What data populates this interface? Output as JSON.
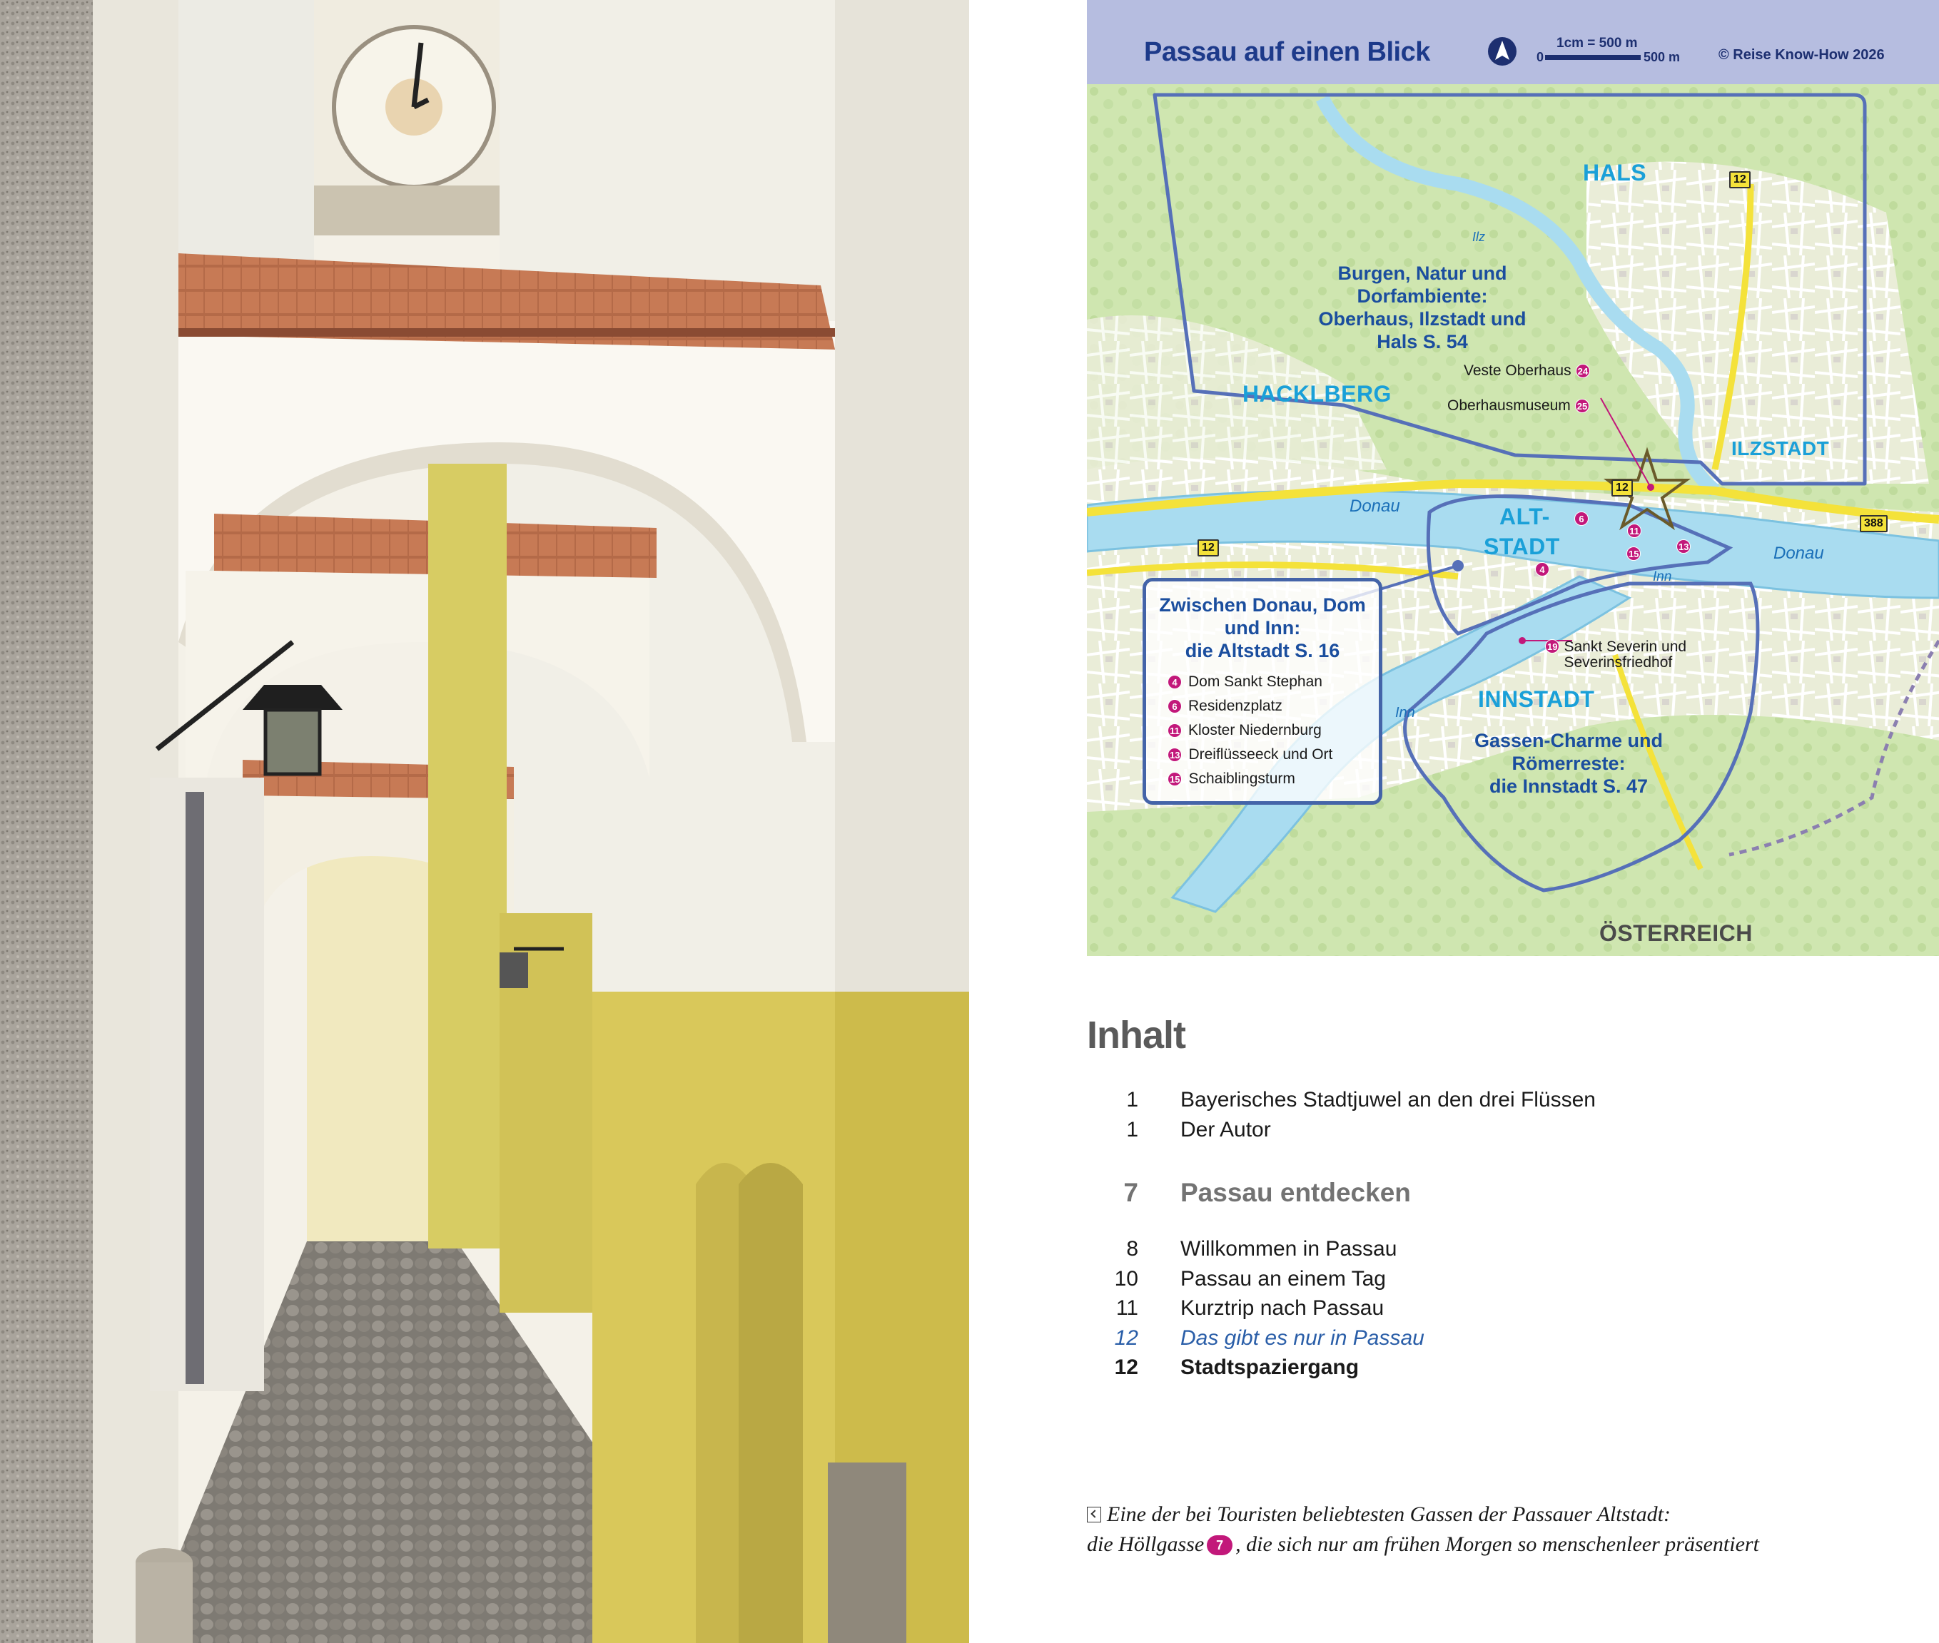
{
  "map": {
    "title": "Passau auf einen Blick",
    "scale": {
      "label": "1cm = 500 m",
      "start": "0",
      "end": "500 m"
    },
    "copyright": "© Reise Know-How 2026",
    "districts": {
      "hals": "HALS",
      "hacklberg": "HACKLBERG",
      "ilzstadt": "ILZSTADT",
      "altstadt_line1": "ALT-",
      "altstadt_line2": "STADT",
      "innstadt": "INNSTADT",
      "oesterreich": "ÖSTERREICH"
    },
    "rivers": {
      "donau_west": "Donau",
      "donau_east": "Donau",
      "inn_center": "Inn",
      "inn_south": "Inn",
      "ilz": "Ilz"
    },
    "roads": {
      "r12_north": "12",
      "r12_center": "12",
      "r12_west": "12",
      "r388": "388"
    },
    "area_north": {
      "line1": "Burgen, Natur und",
      "line2": "Dorfambiente:",
      "line3": "Oberhaus, Ilzstadt und",
      "line4": "Hals S. 54"
    },
    "area_innstadt": {
      "line1": "Gassen-Charme und",
      "line2": "Römerreste:",
      "line3": "die Innstadt S. 47"
    },
    "sights_north": [
      {
        "name": "Veste Oberhaus",
        "num": "24"
      },
      {
        "name": "Oberhausmuseum",
        "num": "25"
      }
    ],
    "sight_innstadt": {
      "name_line1": "Sankt Severin und",
      "name_line2": "Severinsfriedhof",
      "num": "19"
    },
    "altstadt_markers": [
      "6",
      "11",
      "15",
      "13",
      "4"
    ],
    "legend": {
      "title_line1": "Zwischen Donau, Dom",
      "title_line2": "und Inn:",
      "title_line3": "die Altstadt S. 16",
      "items": [
        {
          "num": "4",
          "name": "Dom Sankt Stephan"
        },
        {
          "num": "6",
          "name": "Residenzplatz"
        },
        {
          "num": "11",
          "name": "Kloster Niedernburg"
        },
        {
          "num": "13",
          "name": "Dreiflüsseeck und Ort"
        },
        {
          "num": "15",
          "name": "Schaiblingsturm"
        }
      ]
    }
  },
  "toc": {
    "heading": "Inhalt",
    "entries": [
      {
        "page": "1",
        "title": "Bayerisches Stadtjuwel an den drei Flüssen"
      },
      {
        "page": "1",
        "title": "Der Autor"
      },
      {
        "page": "7",
        "title": "Passau entdecken"
      },
      {
        "page": "8",
        "title": "Willkommen in Passau"
      },
      {
        "page": "10",
        "title": "Passau an einem Tag"
      },
      {
        "page": "11",
        "title": "Kurztrip nach Passau"
      },
      {
        "page": "12",
        "title": "Das gibt es nur in Passau"
      },
      {
        "page": "12",
        "title": "Stadtspaziergang"
      }
    ]
  },
  "caption": {
    "part1": "Eine der bei Touristen beliebtesten Gassen der Passauer Altstadt:",
    "part2": "die Höllgasse",
    "num": "7",
    "part3": ", die sich nur am frühen Morgen so menschenleer präsentiert"
  },
  "colors": {
    "accent_magenta": "#c2187a",
    "map_header": "#b6bde0",
    "map_title": "#1d3a8a",
    "district_blue": "#1aa0d8",
    "river": "#a9dcf0",
    "special_link": "#2a5ea8"
  }
}
